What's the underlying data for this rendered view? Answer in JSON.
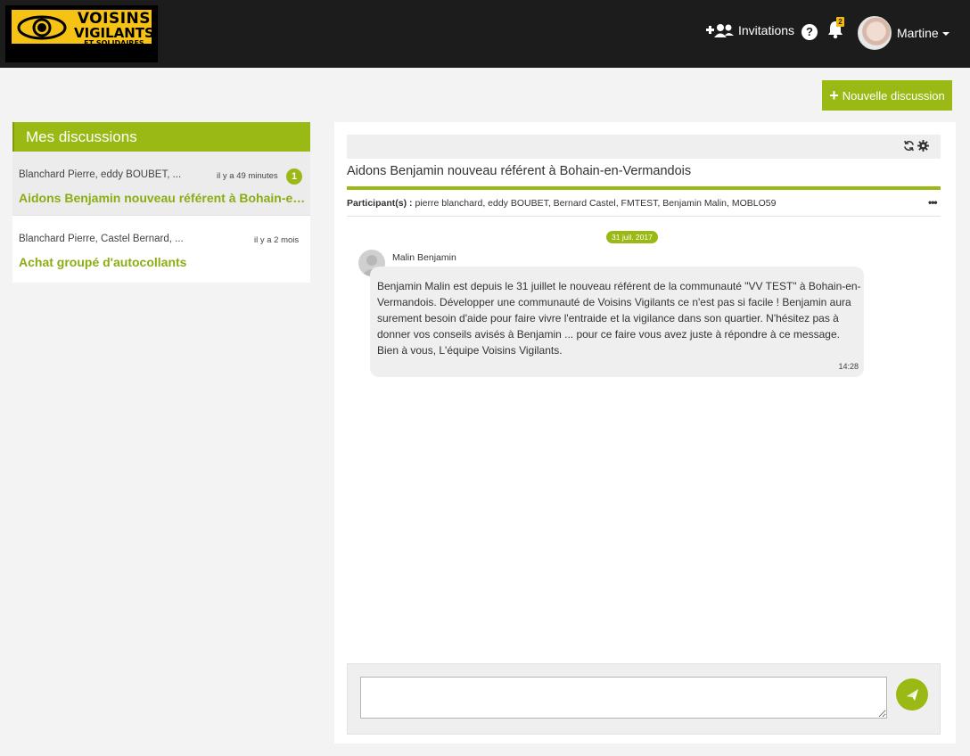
{
  "brand": {
    "line1": "VOISINS",
    "line2": "VIGILANTS",
    "line3": "ET SOLIDAIRES"
  },
  "nav": {
    "invitations_label": "Invitations",
    "help_label": "?",
    "notifications_count": "2",
    "user_name": "Martine"
  },
  "actions": {
    "new_discussion_label": "Nouvelle discussion"
  },
  "discussions": {
    "title": "Mes discussions",
    "items": [
      {
        "participants": "Blanchard Pierre, eddy BOUBET, ...",
        "time": "il y a 49 minutes",
        "unread": "1",
        "subject": "Aidons Benjamin nouveau référent à Bohain-en-Vermandois"
      },
      {
        "participants": "Blanchard Pierre, Castel Bernard, ...",
        "time": "il y a 2 mois",
        "subject": "Achat groupé d'autocollants"
      }
    ]
  },
  "conversation": {
    "title": "Aidons Benjamin nouveau référent à Bohain-en-Vermandois",
    "participants_label": "Participant(s) :",
    "participants": "pierre blanchard, eddy BOUBET, Bernard Castel, FMTEST, Benjamin Malin, MOBLO59",
    "more_label": "•••",
    "date": "31 juil. 2017",
    "message": {
      "author": "Malin Benjamin",
      "text": "Benjamin Malin est depuis le 31 juillet le nouveau référent de la communauté \"VV TEST\" à Bohain-en-Vermandois. Développer une communauté de Voisins Vigilants ce n'est pas si facile ! Benjamin aura surement besoin d'aide pour faire vivre l'entraide et la vigilance dans son quartier. N'hésitez pas à donner vos conseils avisés à Benjamin ... pour ce faire vous avez juste à répondre à ce message. Bien à vous, L'équipe Voisins Vigilants.",
      "time": "14:28"
    },
    "compose_value": ""
  },
  "colors": {
    "accent": "#9ab914",
    "navbar": "#1c1c1c",
    "logo_yellow": "#f6c314"
  },
  "icons": [
    "add-users-icon",
    "help-icon",
    "bell-icon",
    "refresh-icon",
    "gear-icon",
    "send-icon"
  ]
}
